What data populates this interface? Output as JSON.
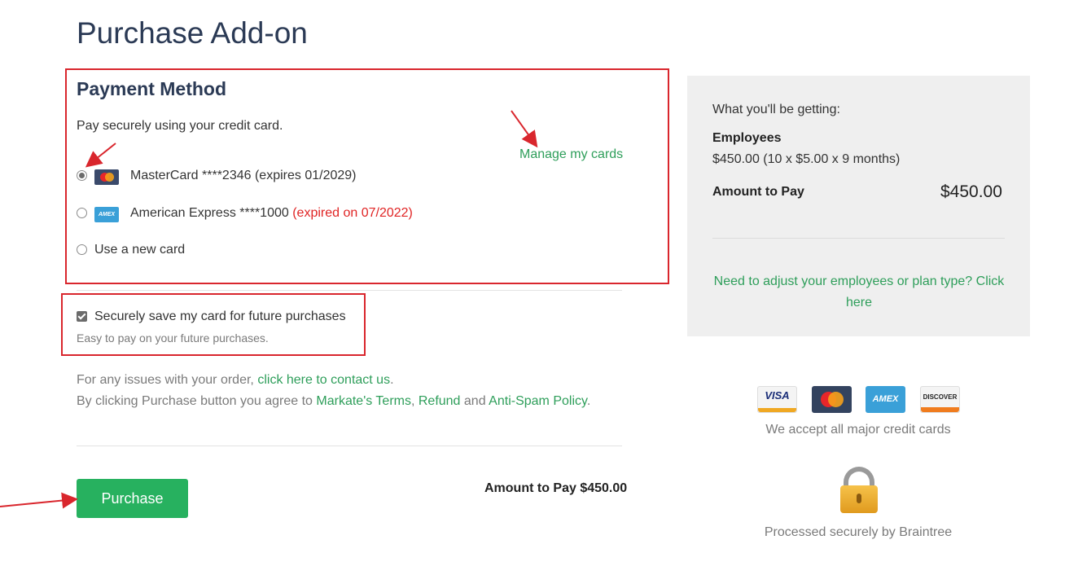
{
  "page": {
    "title": "Purchase Add-on"
  },
  "payment": {
    "heading": "Payment Method",
    "intro": "Pay securely using your credit card.",
    "manage_link": "Manage my cards",
    "options": [
      {
        "icon": "mastercard-icon",
        "label": "MasterCard ****2346 (expires 01/2029)",
        "status": "",
        "selected": true
      },
      {
        "icon": "amex-icon",
        "label": "American Express ****1000",
        "status": "(expired on 07/2022)",
        "selected": false
      },
      {
        "icon": "",
        "label": "Use a new card",
        "status": "",
        "selected": false
      }
    ],
    "save_card": {
      "label": "Securely save my card for future purchases",
      "help": "Easy to pay on your future purchases.",
      "checked": true
    }
  },
  "info": {
    "issues_prefix": "For any issues with your order,",
    "contact_link": "click here to contact us",
    "issues_suffix": ".",
    "terms_prefix": "By clicking Purchase button you agree to",
    "terms_link": "Markate's Terms",
    "refund_link": "Refund",
    "and_text": "and",
    "antispam_link": "Anti-Spam Policy",
    "terms_suffix": "."
  },
  "actions": {
    "purchase_label": "Purchase",
    "amount_label": "Amount to Pay $450.00"
  },
  "summary": {
    "heading": "What you'll be getting:",
    "item_name": "Employees",
    "item_detail": "$450.00 (10 x $5.00 x 9 months)",
    "amount_label": "Amount to Pay",
    "amount_value": "$450.00",
    "adjust_link": "Need to adjust your employees or plan type? Click here"
  },
  "cards": {
    "visa": "VISA",
    "amex": "AMEX",
    "discover": "DISCOVER",
    "caption": "We accept all major credit cards"
  },
  "security": {
    "caption": "Processed securely by Braintree"
  },
  "colors": {
    "accent_green": "#27b15f",
    "link_green": "#2e9e5a",
    "annotation_red": "#d9262d",
    "title_navy": "#2b3a55"
  }
}
